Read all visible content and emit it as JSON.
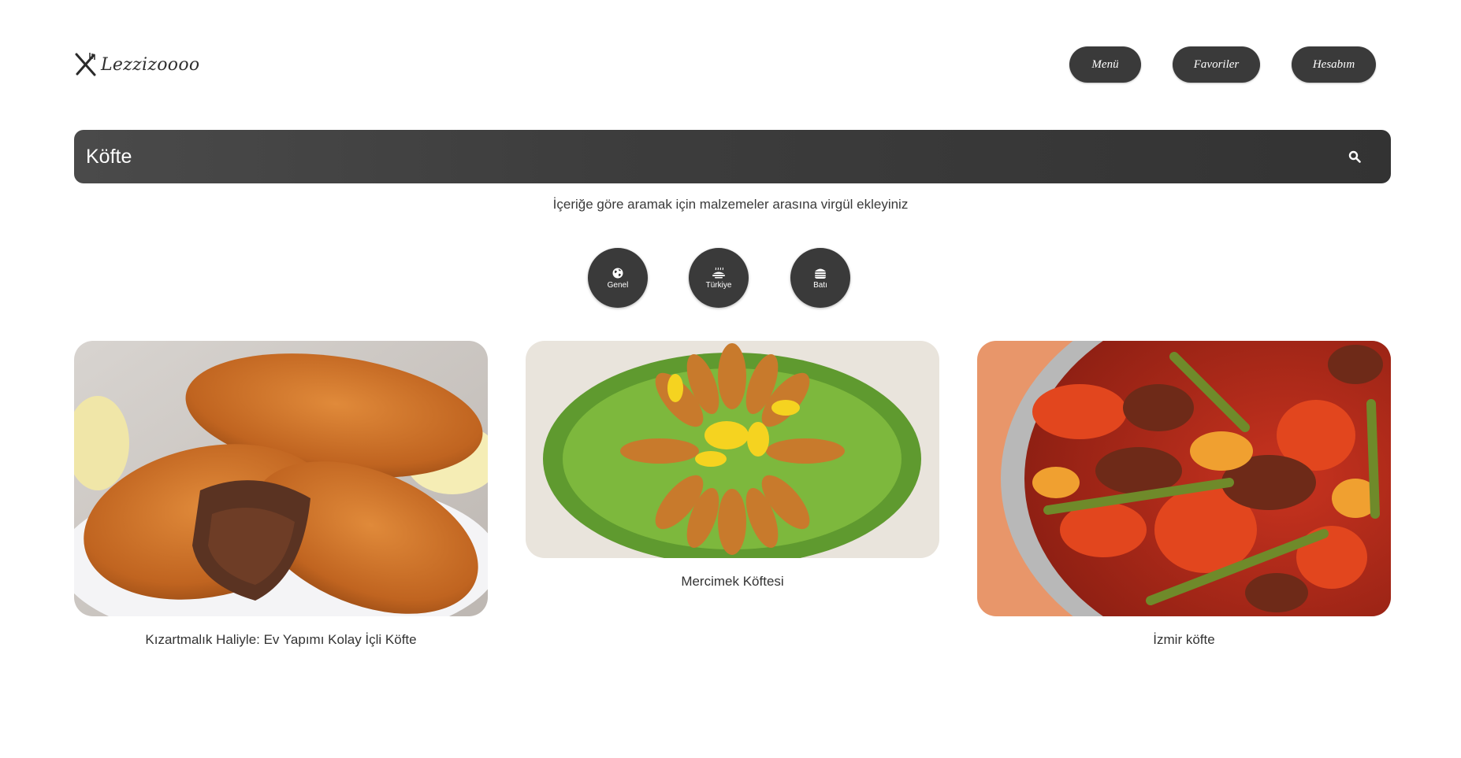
{
  "header": {
    "logo_text": "Lezzizoooo",
    "logo_icon": "fork-knife-icon",
    "nav": {
      "menu_label": "Menü",
      "favorites_label": "Favoriler",
      "account_label": "Hesabım"
    }
  },
  "search": {
    "value": "Köfte",
    "icon": "search-icon",
    "hint": "İçeriğe göre aramak için malzemeler arasına virgül ekleyiniz"
  },
  "categories": [
    {
      "label": "Genel",
      "icon": "globe-icon"
    },
    {
      "label": "Türkiye",
      "icon": "turkish-dish-icon"
    },
    {
      "label": "Batı",
      "icon": "burger-icon"
    }
  ],
  "recipes": [
    {
      "title": "Kızartmalık Haliyle: Ev Yapımı Kolay İçli Köfte",
      "image": "icli-kofte-photo"
    },
    {
      "title": "Mercimek Köftesi",
      "image": "mercimek-koftesi-photo"
    },
    {
      "title": "İzmir köfte",
      "image": "izmir-kofte-photo"
    }
  ],
  "colors": {
    "button_bg": "#3a3a3a",
    "search_bg": "#3d3d3d",
    "page_bg": "#ffffff"
  }
}
